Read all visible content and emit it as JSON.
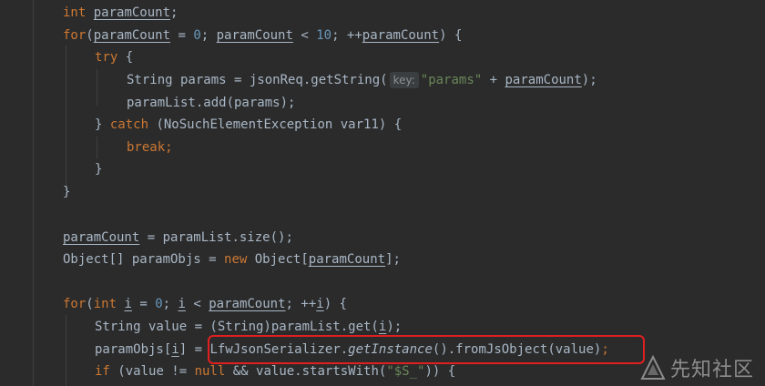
{
  "code": {
    "kw_int": "int",
    "kw_for": "for",
    "kw_try": "try",
    "kw_catch": "catch",
    "kw_break": "break",
    "kw_new": "new",
    "kw_if": "if",
    "kw_null": "null",
    "paramCount": "paramCount",
    "num0": "0",
    "num10": "10",
    "i": "i",
    "string_params_decl": "String params = jsonReq.getString(",
    "hint_key": "key:",
    "str_params": "\"params\"",
    "plus": " + ",
    "close_paren_semi": ");",
    "paramlist_add": "paramList.add(params);",
    "catch_clause": "(NoSuchElementException var11) {",
    "paramlist_size": " = paramList.size();",
    "object_arr": "Object[] paramObjs = ",
    "object_new_arr": "Object[",
    "string_value": "String value = (String)paramList.get(",
    "paramobjs_i": "paramObjs[",
    "serializer": "LfwJsonSerializer.",
    "get_instance": "getInstance",
    "from_js": "().fromJsObject(value)",
    "value_neq": "(value != ",
    "starts_with": " && value.startsWith(",
    "str_ss": "\"$S_\"",
    "close_if": ")) {"
  },
  "watermark": {
    "text": "先知社区"
  }
}
